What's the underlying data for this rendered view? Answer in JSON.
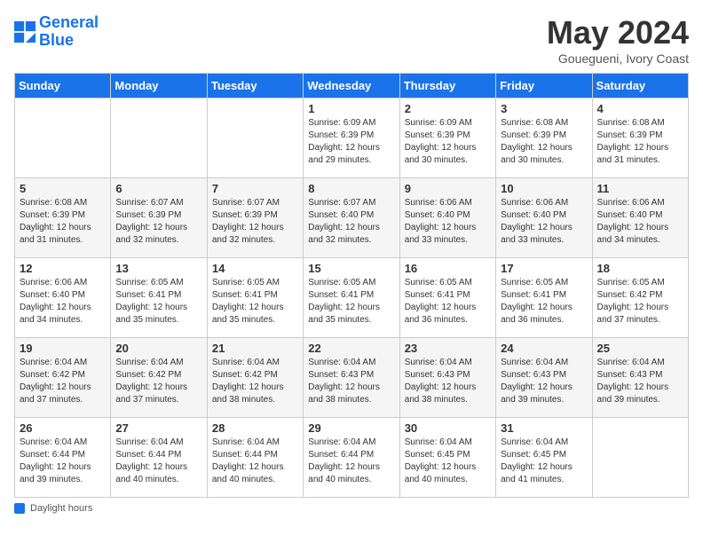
{
  "header": {
    "logo_line1": "General",
    "logo_line2": "Blue",
    "month_title": "May 2024",
    "subtitle": "Gouegueni, Ivory Coast"
  },
  "days_of_week": [
    "Sunday",
    "Monday",
    "Tuesday",
    "Wednesday",
    "Thursday",
    "Friday",
    "Saturday"
  ],
  "weeks": [
    [
      {
        "num": "",
        "info": ""
      },
      {
        "num": "",
        "info": ""
      },
      {
        "num": "",
        "info": ""
      },
      {
        "num": "1",
        "info": "Sunrise: 6:09 AM\nSunset: 6:39 PM\nDaylight: 12 hours and 29 minutes."
      },
      {
        "num": "2",
        "info": "Sunrise: 6:09 AM\nSunset: 6:39 PM\nDaylight: 12 hours and 30 minutes."
      },
      {
        "num": "3",
        "info": "Sunrise: 6:08 AM\nSunset: 6:39 PM\nDaylight: 12 hours and 30 minutes."
      },
      {
        "num": "4",
        "info": "Sunrise: 6:08 AM\nSunset: 6:39 PM\nDaylight: 12 hours and 31 minutes."
      }
    ],
    [
      {
        "num": "5",
        "info": "Sunrise: 6:08 AM\nSunset: 6:39 PM\nDaylight: 12 hours and 31 minutes."
      },
      {
        "num": "6",
        "info": "Sunrise: 6:07 AM\nSunset: 6:39 PM\nDaylight: 12 hours and 32 minutes."
      },
      {
        "num": "7",
        "info": "Sunrise: 6:07 AM\nSunset: 6:39 PM\nDaylight: 12 hours and 32 minutes."
      },
      {
        "num": "8",
        "info": "Sunrise: 6:07 AM\nSunset: 6:40 PM\nDaylight: 12 hours and 32 minutes."
      },
      {
        "num": "9",
        "info": "Sunrise: 6:06 AM\nSunset: 6:40 PM\nDaylight: 12 hours and 33 minutes."
      },
      {
        "num": "10",
        "info": "Sunrise: 6:06 AM\nSunset: 6:40 PM\nDaylight: 12 hours and 33 minutes."
      },
      {
        "num": "11",
        "info": "Sunrise: 6:06 AM\nSunset: 6:40 PM\nDaylight: 12 hours and 34 minutes."
      }
    ],
    [
      {
        "num": "12",
        "info": "Sunrise: 6:06 AM\nSunset: 6:40 PM\nDaylight: 12 hours and 34 minutes."
      },
      {
        "num": "13",
        "info": "Sunrise: 6:05 AM\nSunset: 6:41 PM\nDaylight: 12 hours and 35 minutes."
      },
      {
        "num": "14",
        "info": "Sunrise: 6:05 AM\nSunset: 6:41 PM\nDaylight: 12 hours and 35 minutes."
      },
      {
        "num": "15",
        "info": "Sunrise: 6:05 AM\nSunset: 6:41 PM\nDaylight: 12 hours and 35 minutes."
      },
      {
        "num": "16",
        "info": "Sunrise: 6:05 AM\nSunset: 6:41 PM\nDaylight: 12 hours and 36 minutes."
      },
      {
        "num": "17",
        "info": "Sunrise: 6:05 AM\nSunset: 6:41 PM\nDaylight: 12 hours and 36 minutes."
      },
      {
        "num": "18",
        "info": "Sunrise: 6:05 AM\nSunset: 6:42 PM\nDaylight: 12 hours and 37 minutes."
      }
    ],
    [
      {
        "num": "19",
        "info": "Sunrise: 6:04 AM\nSunset: 6:42 PM\nDaylight: 12 hours and 37 minutes."
      },
      {
        "num": "20",
        "info": "Sunrise: 6:04 AM\nSunset: 6:42 PM\nDaylight: 12 hours and 37 minutes."
      },
      {
        "num": "21",
        "info": "Sunrise: 6:04 AM\nSunset: 6:42 PM\nDaylight: 12 hours and 38 minutes."
      },
      {
        "num": "22",
        "info": "Sunrise: 6:04 AM\nSunset: 6:43 PM\nDaylight: 12 hours and 38 minutes."
      },
      {
        "num": "23",
        "info": "Sunrise: 6:04 AM\nSunset: 6:43 PM\nDaylight: 12 hours and 38 minutes."
      },
      {
        "num": "24",
        "info": "Sunrise: 6:04 AM\nSunset: 6:43 PM\nDaylight: 12 hours and 39 minutes."
      },
      {
        "num": "25",
        "info": "Sunrise: 6:04 AM\nSunset: 6:43 PM\nDaylight: 12 hours and 39 minutes."
      }
    ],
    [
      {
        "num": "26",
        "info": "Sunrise: 6:04 AM\nSunset: 6:44 PM\nDaylight: 12 hours and 39 minutes."
      },
      {
        "num": "27",
        "info": "Sunrise: 6:04 AM\nSunset: 6:44 PM\nDaylight: 12 hours and 40 minutes."
      },
      {
        "num": "28",
        "info": "Sunrise: 6:04 AM\nSunset: 6:44 PM\nDaylight: 12 hours and 40 minutes."
      },
      {
        "num": "29",
        "info": "Sunrise: 6:04 AM\nSunset: 6:44 PM\nDaylight: 12 hours and 40 minutes."
      },
      {
        "num": "30",
        "info": "Sunrise: 6:04 AM\nSunset: 6:45 PM\nDaylight: 12 hours and 40 minutes."
      },
      {
        "num": "31",
        "info": "Sunrise: 6:04 AM\nSunset: 6:45 PM\nDaylight: 12 hours and 41 minutes."
      },
      {
        "num": "",
        "info": ""
      }
    ]
  ],
  "footer": {
    "label": "Daylight hours"
  }
}
